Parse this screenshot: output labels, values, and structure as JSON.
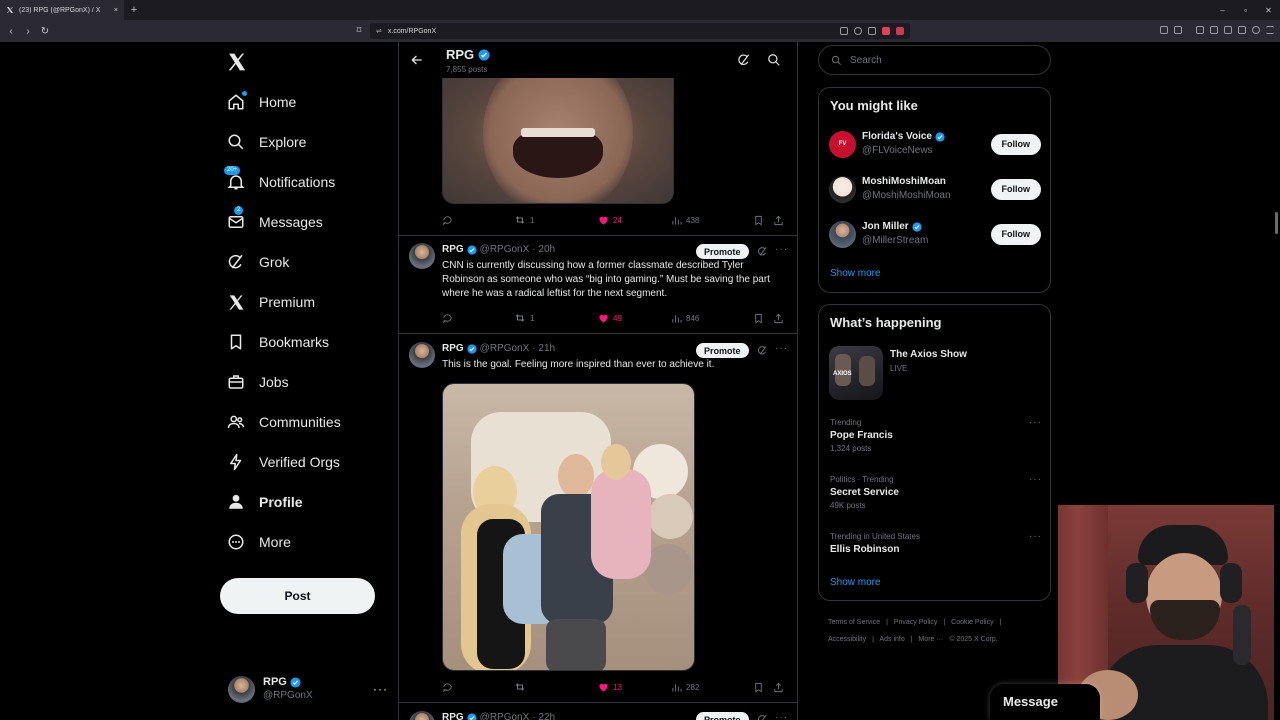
{
  "browser": {
    "tab_title": "(23) RPG (@RPGonX) / X",
    "tab_close": "×",
    "new_tab": "+",
    "url": "x.com/RPGonX"
  },
  "colors": {
    "accent": "#1d9bf0",
    "like": "#f91880",
    "background": "#000000",
    "border": "#2f3336"
  },
  "nav": {
    "items": [
      {
        "label": "Home",
        "icon": "home-icon"
      },
      {
        "label": "Explore",
        "icon": "search-icon"
      },
      {
        "label": "Notifications",
        "icon": "bell-icon",
        "badge": "20+"
      },
      {
        "label": "Messages",
        "icon": "envelope-icon",
        "badge": "2"
      },
      {
        "label": "Grok",
        "icon": "grok-icon"
      },
      {
        "label": "Premium",
        "icon": "x-logo-icon"
      },
      {
        "label": "Bookmarks",
        "icon": "bookmark-icon"
      },
      {
        "label": "Jobs",
        "icon": "briefcase-icon"
      },
      {
        "label": "Communities",
        "icon": "people-icon"
      },
      {
        "label": "Verified Orgs",
        "icon": "lightning-icon"
      },
      {
        "label": "Profile",
        "icon": "person-icon"
      },
      {
        "label": "More",
        "icon": "more-circle-icon"
      }
    ],
    "post_label": "Post",
    "account": {
      "name": "RPG",
      "handle": "@RPGonX"
    }
  },
  "header": {
    "title": "RPG",
    "posts_count": "7,855 posts"
  },
  "first_tweet_actions": {
    "reposts": "1",
    "likes": "24",
    "views": "438"
  },
  "tweets": [
    {
      "name": "RPG",
      "handle": "@RPGonX",
      "time": "· 20h",
      "promote": "Promote",
      "text": "CNN is currently discussing how a former classmate described Tyler Robinson as someone who was “big into gaming.” Must be saving the part where he was a radical leftist for the next segment.",
      "reposts": "1",
      "likes": "49",
      "views": "846"
    },
    {
      "name": "RPG",
      "handle": "@RPGonX",
      "time": "· 21h",
      "promote": "Promote",
      "text": "This is the goal. Feeling more inspired than ever to achieve it.",
      "reposts": "",
      "likes": "13",
      "views": "282"
    },
    {
      "name": "RPG",
      "handle": "@RPGonX",
      "time": "· 22h",
      "promote": "Promote"
    }
  ],
  "search": {
    "placeholder": "Search"
  },
  "you_might_like": {
    "title": "You might like",
    "people": [
      {
        "name": "Florida's Voice",
        "handle": "@FLVoiceNews",
        "follow": "Follow",
        "avatar_color": "#c8102e"
      },
      {
        "name": "MoshiMoshiMoan",
        "handle": "@MoshiMoshiMoan",
        "follow": "Follow",
        "avatar_color": "#f1e3d8"
      },
      {
        "name": "Jon Miller",
        "handle": "@MillerStream",
        "follow": "Follow",
        "avatar_color": "#6b7b8c"
      }
    ],
    "show_more": "Show more"
  },
  "whats_happening": {
    "title": "What’s happening",
    "featured": {
      "name": "The Axios Show",
      "status": "LIVE",
      "thumb_text": "AXIOS"
    },
    "trends": [
      {
        "context": "Trending",
        "name": "Pope Francis",
        "count": "1,324 posts"
      },
      {
        "context": "Politics · Trending",
        "name": "Secret Service",
        "count": "49K posts"
      },
      {
        "context": "Trending in United States",
        "name": "Ellis Robinson",
        "count": ""
      }
    ],
    "show_more": "Show more"
  },
  "footer": {
    "links": [
      "Terms of Service",
      "|",
      "Privacy Policy",
      "|",
      "Cookie Policy",
      "|",
      "Accessibility",
      "|",
      "Ads info",
      "|",
      "More ···",
      "© 2025 X Corp."
    ]
  },
  "messages_drawer": {
    "label": "Message"
  }
}
